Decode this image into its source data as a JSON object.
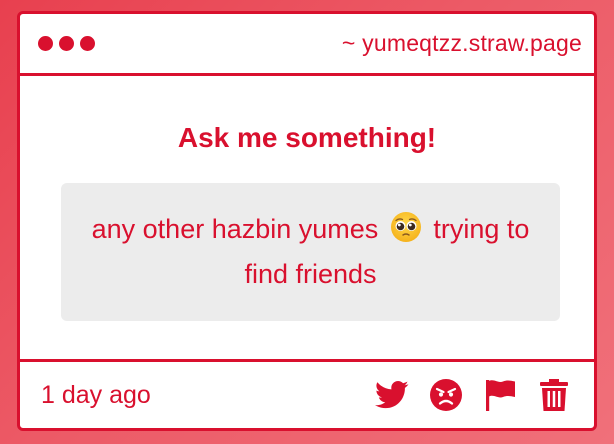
{
  "window": {
    "url": "~ yumeqtzz.straw.page",
    "dots": [
      "dot",
      "dot",
      "dot"
    ]
  },
  "main": {
    "heading": "Ask me something!",
    "question_part1": "any other hazbin yumes",
    "question_emoji": "pleading-face-emoji",
    "question_part2": "trying to find friends"
  },
  "footer": {
    "timestamp": "1 day ago",
    "actions": [
      {
        "name": "twitter-icon"
      },
      {
        "name": "angry-face-icon"
      },
      {
        "name": "flag-icon"
      },
      {
        "name": "trash-icon"
      }
    ]
  },
  "colors": {
    "accent": "#d9102e",
    "question_bg": "#ececec",
    "page_bg": "#ec5a66"
  }
}
